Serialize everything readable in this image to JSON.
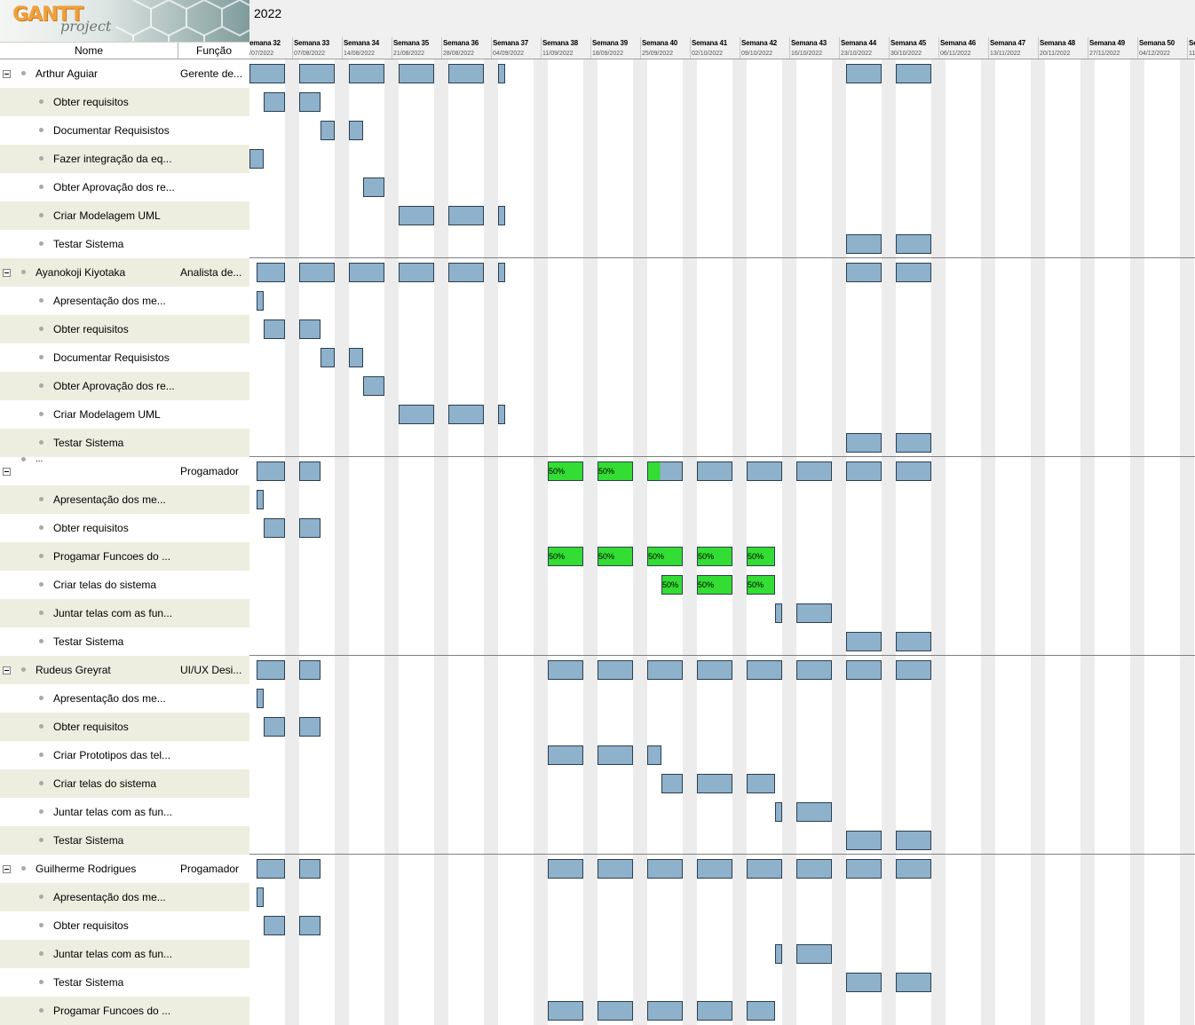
{
  "app": {
    "logo_main": "GANTT",
    "logo_sub": "project"
  },
  "columns": {
    "name": "Nome",
    "function": "Função"
  },
  "timeline": {
    "year": "2022",
    "weeks": [
      {
        "label": "emana 32",
        "date": "/07/2022"
      },
      {
        "label": "Semana 33",
        "date": "07/08/2022"
      },
      {
        "label": "Semana 34",
        "date": "14/08/2022"
      },
      {
        "label": "Semana 35",
        "date": "21/08/2022"
      },
      {
        "label": "Semana 36",
        "date": "28/08/2022"
      },
      {
        "label": "Semana 37",
        "date": "04/09/2022"
      },
      {
        "label": "Semana 38",
        "date": "11/09/2022"
      },
      {
        "label": "Semana 39",
        "date": "18/09/2022"
      },
      {
        "label": "Semana 40",
        "date": "25/09/2022"
      },
      {
        "label": "Semana 41",
        "date": "02/10/2022"
      },
      {
        "label": "Semana 42",
        "date": "09/10/2022"
      },
      {
        "label": "Semana 43",
        "date": "16/10/2022"
      },
      {
        "label": "Semana 44",
        "date": "23/10/2022"
      },
      {
        "label": "Semana 45",
        "date": "30/10/2022"
      },
      {
        "label": "Semana 46",
        "date": "06/11/2022"
      },
      {
        "label": "Semana 47",
        "date": "13/11/2022"
      },
      {
        "label": "Semana 48",
        "date": "20/11/2022"
      },
      {
        "label": "Semana 49",
        "date": "27/11/2022"
      },
      {
        "label": "Semana 50",
        "date": "04/12/2022"
      },
      {
        "label": "Se",
        "date": "11"
      }
    ]
  },
  "rows": [
    {
      "type": "resource",
      "name": "Arthur Aguiar",
      "function": "Gerente de...",
      "bars": [
        [
          0,
          5
        ],
        [
          7,
          12
        ],
        [
          14,
          19
        ],
        [
          21,
          26
        ],
        [
          28,
          33
        ],
        [
          35,
          36
        ],
        [
          84,
          89
        ],
        [
          91,
          96
        ]
      ]
    },
    {
      "type": "task",
      "name": "Obter requisitos",
      "bars": [
        [
          2,
          5
        ],
        [
          7,
          10
        ]
      ]
    },
    {
      "type": "task",
      "name": "Documentar Requisistos",
      "bars": [
        [
          10,
          12
        ],
        [
          14,
          16
        ]
      ]
    },
    {
      "type": "task",
      "name": "Fazer integração da eq...",
      "bars": [
        [
          0,
          2
        ]
      ]
    },
    {
      "type": "task",
      "name": "Obter Aprovação dos re...",
      "bars": [
        [
          16,
          19
        ]
      ]
    },
    {
      "type": "task",
      "name": "Criar Modelagem UML",
      "bars": [
        [
          21,
          26
        ],
        [
          28,
          33
        ],
        [
          35,
          36
        ]
      ]
    },
    {
      "type": "task",
      "name": "Testar Sistema",
      "bars": [
        [
          84,
          89
        ],
        [
          91,
          96
        ]
      ]
    },
    {
      "type": "resource",
      "name": "Ayanokoji Kiyotaka",
      "function": "Analista de...",
      "bars": [
        [
          1,
          5
        ],
        [
          7,
          12
        ],
        [
          14,
          19
        ],
        [
          21,
          26
        ],
        [
          28,
          33
        ],
        [
          35,
          36
        ],
        [
          84,
          89
        ],
        [
          91,
          96
        ]
      ]
    },
    {
      "type": "task",
      "name": "Apresentação dos me...",
      "bars": [
        [
          1,
          2
        ]
      ]
    },
    {
      "type": "task",
      "name": "Obter requisitos",
      "bars": [
        [
          2,
          5
        ],
        [
          7,
          10
        ]
      ]
    },
    {
      "type": "task",
      "name": "Documentar Requisistos",
      "bars": [
        [
          10,
          12
        ],
        [
          14,
          16
        ]
      ]
    },
    {
      "type": "task",
      "name": "Obter Aprovação dos re...",
      "bars": [
        [
          16,
          19
        ]
      ]
    },
    {
      "type": "task",
      "name": "Criar Modelagem UML",
      "bars": [
        [
          21,
          26
        ],
        [
          28,
          33
        ],
        [
          35,
          36
        ]
      ]
    },
    {
      "type": "task",
      "name": "Testar Sistema",
      "bars": [
        [
          84,
          89
        ],
        [
          91,
          96
        ]
      ]
    },
    {
      "type": "resource",
      "name": "...",
      "function": "Progamador",
      "bars": [
        [
          1,
          5
        ],
        [
          7,
          10
        ],
        [
          42,
          47,
          "done",
          "50%"
        ],
        [
          49,
          54,
          "done",
          "50%"
        ],
        [
          56,
          61,
          "partial",
          ""
        ],
        [
          63,
          68
        ],
        [
          70,
          75
        ],
        [
          77,
          82
        ],
        [
          84,
          89
        ],
        [
          91,
          96
        ]
      ]
    },
    {
      "type": "task",
      "name": "Apresentação dos me...",
      "bars": [
        [
          1,
          2
        ]
      ]
    },
    {
      "type": "task",
      "name": "Obter requisitos",
      "bars": [
        [
          2,
          5
        ],
        [
          7,
          10
        ]
      ]
    },
    {
      "type": "task",
      "name": "Progamar Funcoes do ...",
      "bars": [
        [
          42,
          47,
          "done",
          "50%"
        ],
        [
          49,
          54,
          "done",
          "50%"
        ],
        [
          56,
          61,
          "done",
          "50%"
        ],
        [
          63,
          68,
          "done",
          "50%"
        ],
        [
          70,
          74,
          "done",
          "50%"
        ]
      ]
    },
    {
      "type": "task",
      "name": "Criar telas do sistema",
      "bars": [
        [
          58,
          61,
          "done",
          "50%"
        ],
        [
          63,
          68,
          "done",
          "50%"
        ],
        [
          70,
          74,
          "done",
          "50%"
        ]
      ]
    },
    {
      "type": "task",
      "name": "Juntar telas com as fun...",
      "bars": [
        [
          74,
          75
        ],
        [
          77,
          82
        ]
      ]
    },
    {
      "type": "task",
      "name": "Testar Sistema",
      "bars": [
        [
          84,
          89
        ],
        [
          91,
          96
        ]
      ]
    },
    {
      "type": "resource",
      "name": "Rudeus Greyrat",
      "function": "UI/UX Desi...",
      "bars": [
        [
          1,
          5
        ],
        [
          7,
          10
        ],
        [
          42,
          47
        ],
        [
          49,
          54
        ],
        [
          56,
          61
        ],
        [
          63,
          68
        ],
        [
          70,
          75
        ],
        [
          77,
          82
        ],
        [
          84,
          89
        ],
        [
          91,
          96
        ]
      ]
    },
    {
      "type": "task",
      "name": "Apresentação dos me...",
      "bars": [
        [
          1,
          2
        ]
      ]
    },
    {
      "type": "task",
      "name": "Obter requisitos",
      "bars": [
        [
          2,
          5
        ],
        [
          7,
          10
        ]
      ]
    },
    {
      "type": "task",
      "name": "Criar Prototipos das tel...",
      "bars": [
        [
          42,
          47
        ],
        [
          49,
          54
        ],
        [
          56,
          58
        ]
      ]
    },
    {
      "type": "task",
      "name": "Criar telas do sistema",
      "bars": [
        [
          58,
          61
        ],
        [
          63,
          68
        ],
        [
          70,
          74
        ]
      ]
    },
    {
      "type": "task",
      "name": "Juntar telas com as fun...",
      "bars": [
        [
          74,
          75
        ],
        [
          77,
          82
        ]
      ]
    },
    {
      "type": "task",
      "name": "Testar Sistema",
      "bars": [
        [
          84,
          89
        ],
        [
          91,
          96
        ]
      ]
    },
    {
      "type": "resource",
      "name": "Guilherme Rodrigues",
      "function": "Progamador",
      "bars": [
        [
          1,
          5
        ],
        [
          7,
          10
        ],
        [
          42,
          47
        ],
        [
          49,
          54
        ],
        [
          56,
          61
        ],
        [
          63,
          68
        ],
        [
          70,
          75
        ],
        [
          77,
          82
        ],
        [
          84,
          89
        ],
        [
          91,
          96
        ]
      ]
    },
    {
      "type": "task",
      "name": "Apresentação dos me...",
      "bars": [
        [
          1,
          2
        ]
      ]
    },
    {
      "type": "task",
      "name": "Obter requisitos",
      "bars": [
        [
          2,
          5
        ],
        [
          7,
          10
        ]
      ]
    },
    {
      "type": "task",
      "name": "Juntar telas com as fun...",
      "bars": [
        [
          74,
          75
        ],
        [
          77,
          82
        ]
      ]
    },
    {
      "type": "task",
      "name": "Testar Sistema",
      "bars": [
        [
          84,
          89
        ],
        [
          91,
          96
        ]
      ]
    },
    {
      "type": "task",
      "name": "Progamar Funcoes do ...",
      "bars": [
        [
          42,
          47
        ],
        [
          49,
          54
        ],
        [
          56,
          61
        ],
        [
          63,
          68
        ],
        [
          70,
          74
        ]
      ]
    }
  ]
}
